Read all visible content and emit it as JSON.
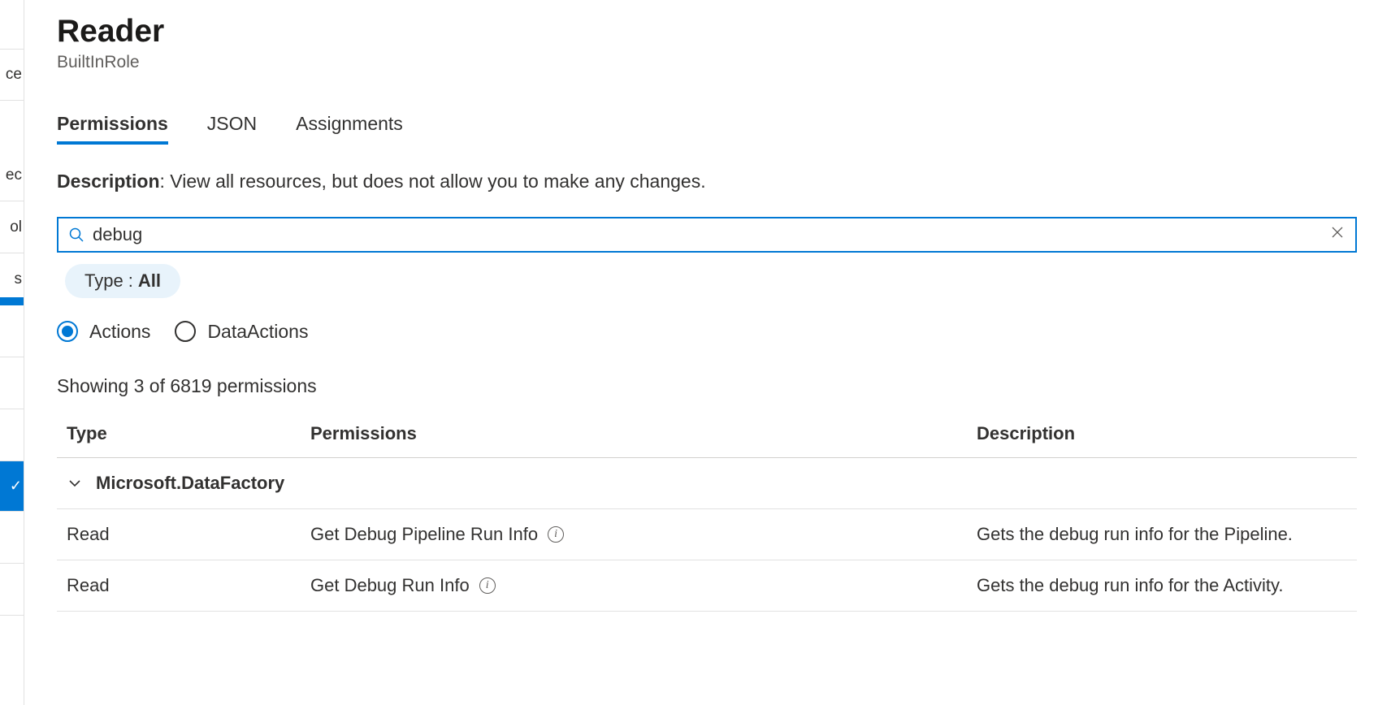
{
  "leftRail": {
    "items": [
      "ce",
      "ec",
      "ol",
      "s"
    ]
  },
  "header": {
    "title": "Reader",
    "subtitle": "BuiltInRole"
  },
  "tabs": [
    {
      "label": "Permissions",
      "active": true
    },
    {
      "label": "JSON",
      "active": false
    },
    {
      "label": "Assignments",
      "active": false
    }
  ],
  "description": {
    "label": "Description",
    "text": ": View all resources, but does not allow you to make any changes."
  },
  "search": {
    "value": "debug",
    "placeholder": ""
  },
  "filter": {
    "label": "Type : ",
    "value": "All"
  },
  "radios": {
    "actions": "Actions",
    "dataActions": "DataActions",
    "selected": "actions"
  },
  "resultCount": "Showing 3 of 6819 permissions",
  "columns": {
    "type": "Type",
    "permissions": "Permissions",
    "description": "Description"
  },
  "group": {
    "name": "Microsoft.DataFactory"
  },
  "rows": [
    {
      "type": "Read",
      "permission": "Get Debug Pipeline Run Info",
      "description": "Gets the debug run info for the Pipeline."
    },
    {
      "type": "Read",
      "permission": "Get Debug Run Info",
      "description": "Gets the debug run info for the Activity."
    }
  ]
}
